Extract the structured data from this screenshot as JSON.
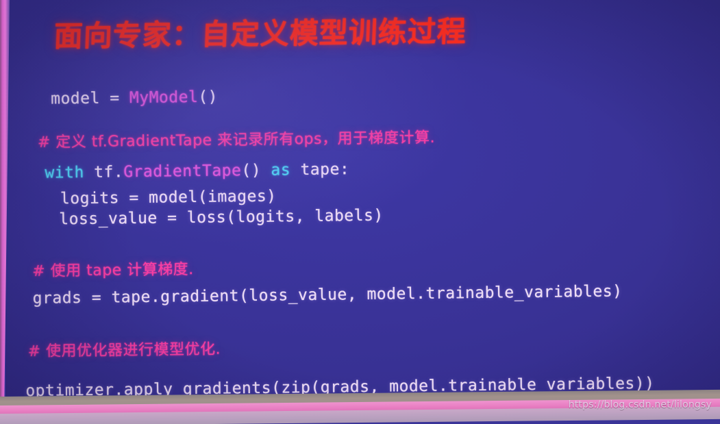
{
  "slide": {
    "title": "面向专家：自定义模型训练过程",
    "title_color": "#ff2e21",
    "background_color": "#3a3498",
    "code_lines": [
      {
        "id": "model",
        "tokens": [
          {
            "text": "model = ",
            "type": "plain"
          },
          {
            "text": "MyModel",
            "type": "class"
          },
          {
            "text": "()",
            "type": "plain"
          }
        ]
      },
      {
        "id": "comment-gradienttape",
        "tokens": [
          {
            "text": "# 定义 tf.GradientTape 来记录所有ops，用于梯度计算.",
            "type": "comment"
          }
        ]
      },
      {
        "id": "with-gradienttape",
        "tokens": [
          {
            "text": "with",
            "type": "keyword"
          },
          {
            "text": " tf.",
            "type": "plain"
          },
          {
            "text": "GradientTape",
            "type": "class"
          },
          {
            "text": "() ",
            "type": "plain"
          },
          {
            "text": "as",
            "type": "keyword"
          },
          {
            "text": " tape:",
            "type": "plain"
          }
        ]
      },
      {
        "id": "logits",
        "tokens": [
          {
            "text": "logits = model(images)",
            "type": "plain"
          }
        ]
      },
      {
        "id": "loss-value",
        "tokens": [
          {
            "text": "loss_value = loss(logits, labels)",
            "type": "plain"
          }
        ]
      },
      {
        "id": "comment-tape",
        "tokens": [
          {
            "text": "# 使用 tape 计算梯度.",
            "type": "comment"
          }
        ]
      },
      {
        "id": "grads",
        "tokens": [
          {
            "text": "grads = tape.gradient(loss_value, model.trainable_variables)",
            "type": "plain"
          }
        ]
      },
      {
        "id": "comment-optimizer",
        "tokens": [
          {
            "text": "# 使用优化器进行模型优化.",
            "type": "comment"
          }
        ]
      },
      {
        "id": "optimizer",
        "tokens": [
          {
            "text": "optimizer.apply_gradients(zip(grads, model.trainable_variables))",
            "type": "plain"
          }
        ]
      }
    ],
    "line_text": {
      "model_plain_1": "model = ",
      "model_class": "MyModel",
      "model_plain_2": "()",
      "comment_gradienttape": "# 定义 tf.GradientTape 来记录所有ops，用于梯度计算.",
      "with_kw": "with",
      "with_tf": " tf.",
      "with_class": "GradientTape",
      "with_parens": "() ",
      "as_kw": "as",
      "with_tape": " tape:",
      "logits": "logits = model(images)",
      "loss_value": "loss_value = loss(logits, labels)",
      "comment_tape": "# 使用 tape 计算梯度.",
      "grads": "grads = tape.gradient(loss_value, model.trainable_variables)",
      "comment_optimizer": "# 使用优化器进行模型优化.",
      "optimizer": "optimizer.apply_gradients(zip(grads, model.trainable_variables))"
    },
    "syntax_colors": {
      "plain": "#eddcf5",
      "class": "#e358dd",
      "keyword": "#4fd6f5",
      "comment": "#fb3ea3"
    }
  },
  "watermark": {
    "url": "https://blog.csdn.net/lilongsy"
  }
}
